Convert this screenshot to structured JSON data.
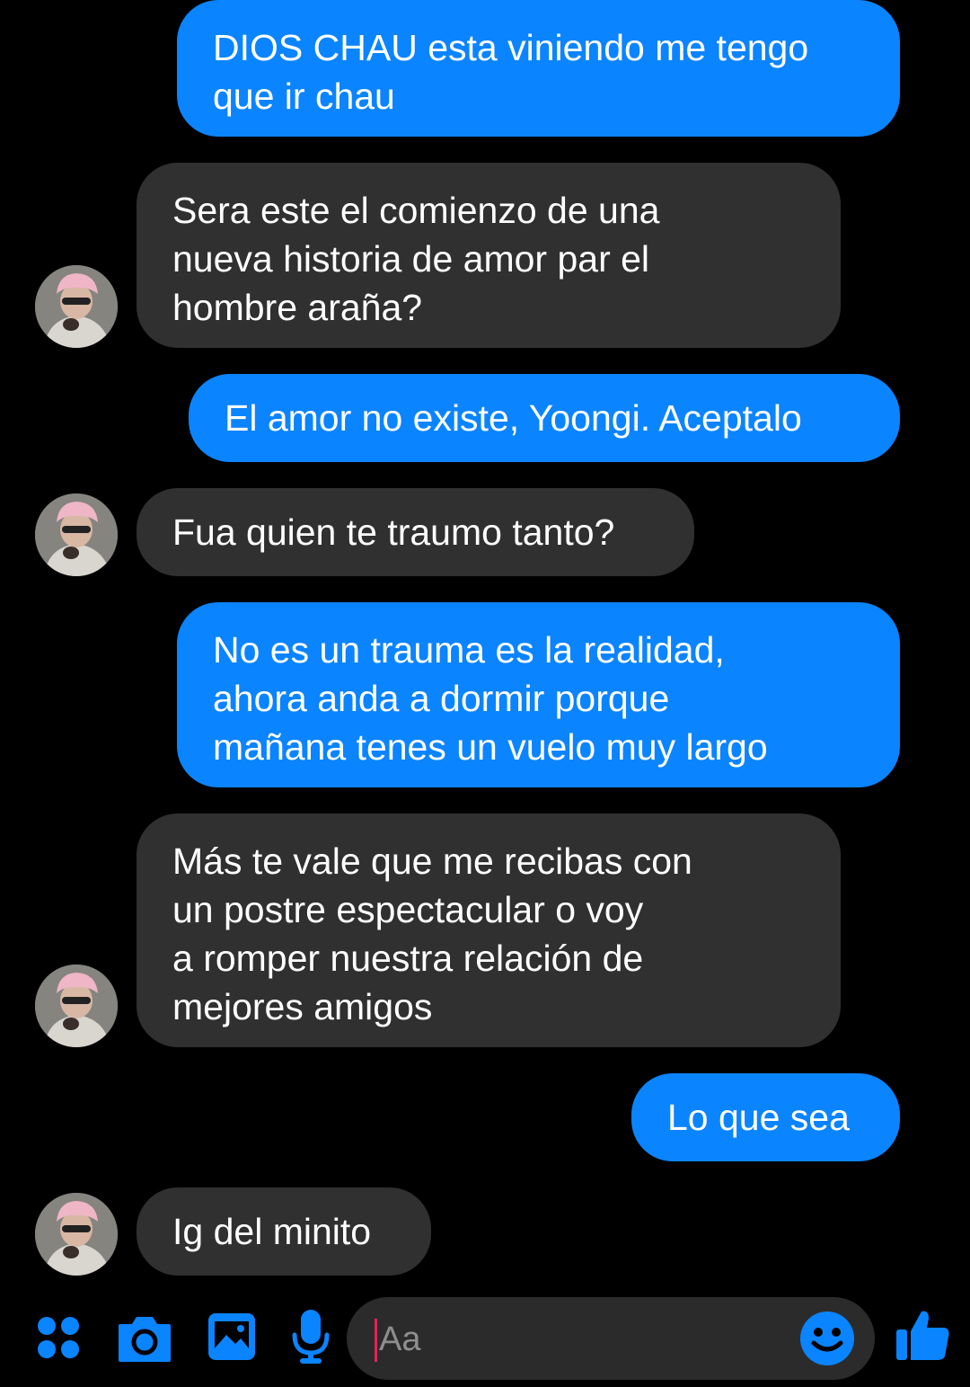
{
  "conversation": {
    "messages": [
      {
        "direction": "outgoing",
        "text": "DIOS CHAU esta viniendo me tengo\nque ir chau"
      },
      {
        "direction": "incoming",
        "text": "Sera este el comienzo de una\nnueva historia de amor par el\nhombre araña?"
      },
      {
        "direction": "outgoing",
        "text": "El amor no existe, Yoongi. Aceptalo"
      },
      {
        "direction": "incoming",
        "text": "Fua quien te traumo tanto?"
      },
      {
        "direction": "outgoing",
        "text": "No es un trauma es la realidad,\nahora anda a dormir porque\nmañana tenes un vuelo muy largo"
      },
      {
        "direction": "incoming",
        "text": "Más te vale que me recibas con\nun postre espectacular o voy\na romper nuestra relación de\nmejores amigos"
      },
      {
        "direction": "outgoing",
        "text": "Lo que sea"
      },
      {
        "direction": "incoming",
        "text": "Ig del minito"
      }
    ]
  },
  "composer": {
    "placeholder": "Aa",
    "icons": [
      "menu-dots-icon",
      "camera-icon",
      "gallery-icon",
      "microphone-icon",
      "emoji-icon",
      "thumbs-up-icon"
    ]
  },
  "colors": {
    "background": "#000000",
    "outgoing_bubble": "#0b84ff",
    "incoming_bubble": "#303030",
    "accent": "#0b84ff",
    "input_background": "#2b2b2b",
    "caret": "#e0245e"
  }
}
